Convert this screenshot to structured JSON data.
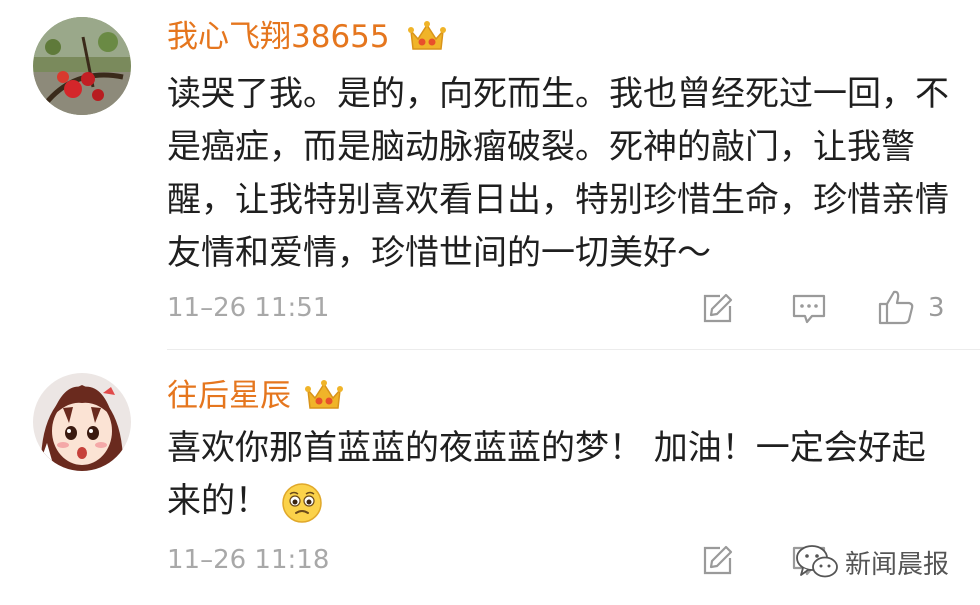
{
  "comments": [
    {
      "username": "我心飞翔38655",
      "text": "读哭了我。是的，向死而生。我也曾经死过一回，不是癌症，而是脑动脉瘤破裂。死神的敲门，让我警醒，让我特别喜欢看日出，特别珍惜生命，珍惜亲情友情和爱情，珍惜世间的一切美好～",
      "timestamp": "11–26 11:51",
      "like_count": "3"
    },
    {
      "username": "往后星辰",
      "text": "喜欢你那首蓝蓝的夜蓝蓝的梦！ 加油！一定会好起来的！",
      "timestamp": "11–26 11:18"
    }
  ],
  "watermark": "新闻晨报",
  "colors": {
    "username": "#e5761e",
    "crown": "#f0b429",
    "text": "#1f1f1f",
    "meta": "#a8a8a8"
  },
  "icons": [
    "crown-icon",
    "share-icon",
    "comment-icon",
    "like-icon",
    "emoji-sad-icon",
    "wechat-icon"
  ]
}
